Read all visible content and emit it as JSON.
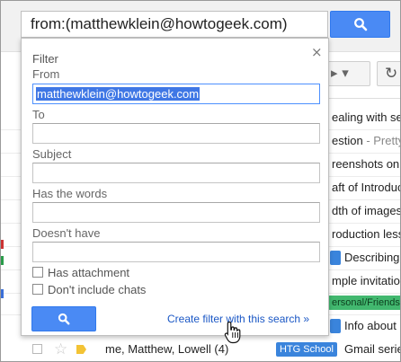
{
  "search": {
    "query": "from:(matthewklein@howtogeek.com)"
  },
  "filter_panel": {
    "title": "Filter",
    "close": "×",
    "from_label": "From",
    "from_value": "matthewklein@howtogeek.com",
    "to_label": "To",
    "to_value": "",
    "subject_label": "Subject",
    "subject_value": "",
    "has_words_label": "Has the words",
    "has_words_value": "",
    "doesnt_have_label": "Doesn't have",
    "doesnt_have_value": "",
    "has_attachment_label": "Has attachment",
    "no_chats_label": "Don't include chats",
    "create_filter_link": "Create filter with this search »"
  },
  "email_list": {
    "rows": [
      {
        "snippet": "ealing with sett"
      },
      {
        "snippet": "estion",
        "snippet_more": " - Pretty"
      },
      {
        "snippet": "reenshots on"
      },
      {
        "snippet": "aft of Introduct"
      },
      {
        "snippet": "dth of images"
      },
      {
        "snippet": "roduction less"
      },
      {
        "snippet": "Describing",
        "chip_label": ""
      },
      {
        "snippet": "mple invitation"
      },
      {
        "chip_label": "ersonal/Friends"
      },
      {
        "snippet": "Info about",
        "chip_label": ""
      }
    ],
    "last_row": {
      "sender": "me, Matthew, Lowell (4)",
      "label": "HTG School",
      "subject": "Gmail serie"
    }
  },
  "icons": {
    "search": "search-icon",
    "close": "close-icon",
    "refresh": "refresh-icon",
    "star": "star-icon",
    "label": "label-tag-icon",
    "cursor": "hand-cursor-icon"
  },
  "colors": {
    "accent_blue": "#4a8af4",
    "link_blue": "#1a57c5",
    "selection": "#3f77e5",
    "label_blue": "#3a84dc",
    "label_green": "#42b86f"
  }
}
